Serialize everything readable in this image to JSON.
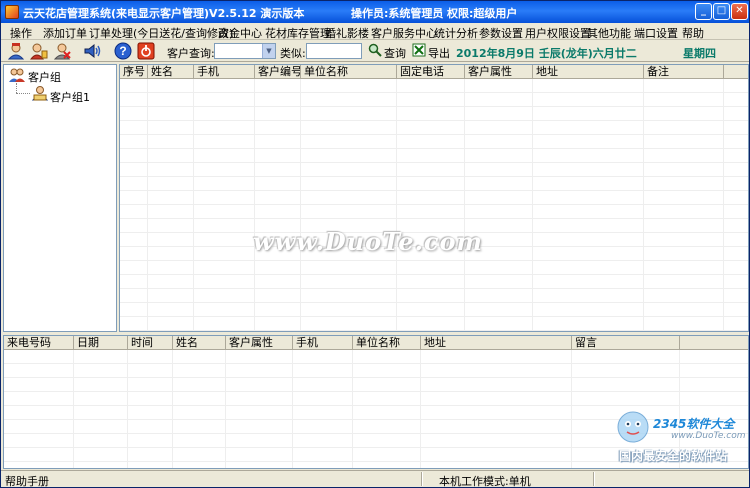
{
  "title": {
    "app_title": "云天花店管理系统(来电显示客户管理)V2.5.12 演示版本",
    "operator": "操作员:系统管理员",
    "permission": "权限:超级用户"
  },
  "menu": {
    "items": [
      "操作",
      "添加订单",
      "订单处理(今日送花/查询修改)",
      "资金中心",
      "花材库存管理",
      "婚礼影楼",
      "客户服务中心",
      "统计分析",
      "参数设置",
      "用户权限设置",
      "其他功能",
      "端口设置",
      "帮助"
    ]
  },
  "toolbar": {
    "customer_query_label": "客户查询:",
    "customer_query_value": "",
    "similar_label": "类似:",
    "similar_value": "",
    "query_button": "查询",
    "export_button": "导出",
    "date_text": "2012年8月9日 壬辰(龙年)六月廿二",
    "weekday_text": "星期四"
  },
  "tree": {
    "root": "客户组",
    "children": [
      "客户组1"
    ]
  },
  "customer_grid": {
    "columns": [
      "序号",
      "姓名",
      "手机",
      "客户编号",
      "单位名称",
      "固定电话",
      "客户属性",
      "地址",
      "备注"
    ]
  },
  "call_grid": {
    "columns": [
      "来电号码",
      "日期",
      "时间",
      "姓名",
      "客户属性",
      "手机",
      "单位名称",
      "地址",
      "留言"
    ]
  },
  "status": {
    "help": "帮助手册",
    "work_mode": "本机工作模式:单机"
  },
  "watermark": {
    "duote": "www.DuoTe.com",
    "brand": "2345软件大全",
    "url": "www.DuoTe.com",
    "slogan": "国内最安全的软件站"
  },
  "colors": {
    "titlebar": "#0b5ee8",
    "date_text": "#0a7a6a",
    "grid_border": "#7f9db9"
  }
}
